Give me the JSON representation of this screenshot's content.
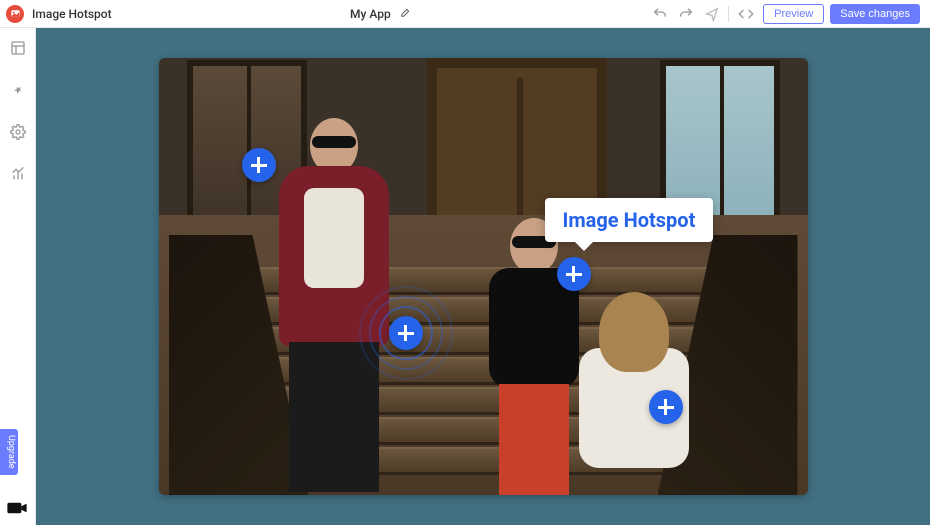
{
  "header": {
    "app_title": "Image Hotspot",
    "project_name": "My App",
    "preview_label": "Preview",
    "save_label": "Save changes"
  },
  "sidebar": {
    "upgrade_label": "Upgrade"
  },
  "hotspots": {
    "tooltip_label": "Image Hotspot"
  },
  "colors": {
    "accent": "#2563eb",
    "primary_btn": "#6b7cff",
    "canvas_bg": "#417082"
  }
}
